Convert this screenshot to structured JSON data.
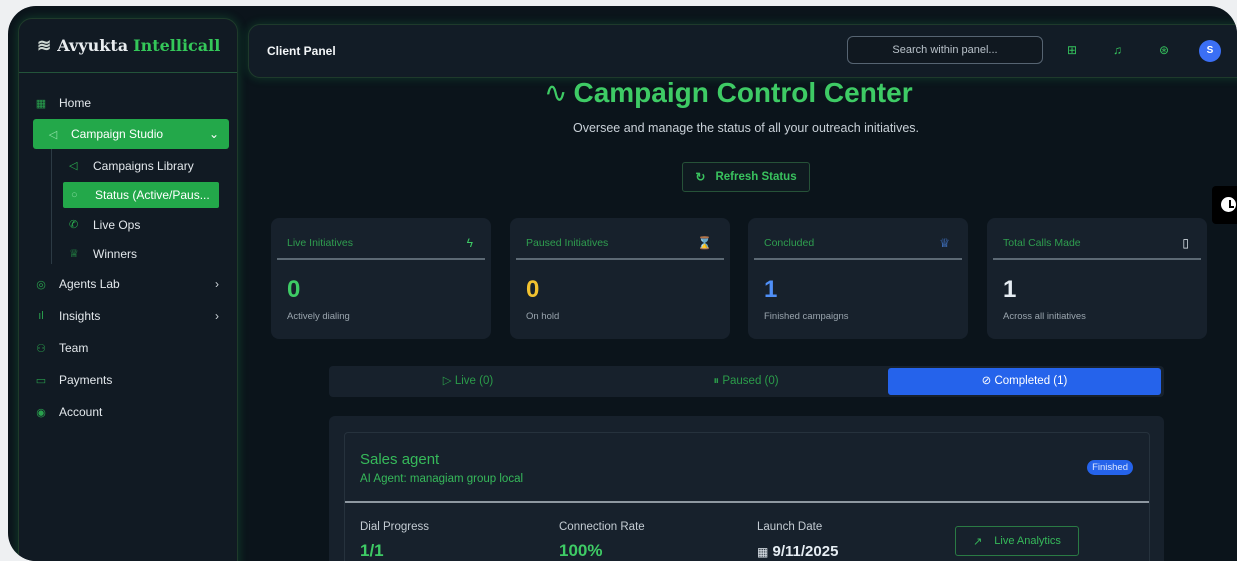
{
  "brand": {
    "part1": "Avyukta",
    "part2": "Intellicall"
  },
  "sidebar": {
    "items": [
      {
        "label": "Home",
        "icon": "grid-icon"
      },
      {
        "label": "Campaign Studio",
        "icon": "megaphone-icon"
      },
      {
        "label": "Agents Lab",
        "icon": "robot-icon"
      },
      {
        "label": "Insights",
        "icon": "bar-chart-icon"
      },
      {
        "label": "Team",
        "icon": "users-icon"
      },
      {
        "label": "Payments",
        "icon": "credit-card-icon"
      },
      {
        "label": "Account",
        "icon": "user-circle-icon"
      }
    ],
    "subitems": [
      {
        "label": "Campaigns Library",
        "icon": "megaphone-icon"
      },
      {
        "label": "Status (Active/Paus...",
        "icon": "circle-icon"
      },
      {
        "label": "Live Ops",
        "icon": "phone-icon"
      },
      {
        "label": "Winners",
        "icon": "trophy-icon"
      }
    ]
  },
  "topbar": {
    "title": "Client Panel",
    "search_placeholder": "Search within panel...",
    "avatar_letter": "S"
  },
  "main": {
    "title": "Campaign Control Center",
    "subtitle": "Oversee and manage the status of all your outreach initiatives.",
    "refresh_label": "Refresh Status"
  },
  "cards": [
    {
      "label": "Live Initiatives",
      "value": "0",
      "desc": "Actively dialing",
      "icon": "lightning-icon",
      "color": "#3ecb65"
    },
    {
      "label": "Paused Initiatives",
      "value": "0",
      "desc": "On hold",
      "icon": "hourglass-icon",
      "color": "#f2c230"
    },
    {
      "label": "Concluded",
      "value": "1",
      "desc": "Finished campaigns",
      "icon": "trophy-icon",
      "color": "#4f8ff7"
    },
    {
      "label": "Total Calls Made",
      "value": "1",
      "desc": "Across all initiatives",
      "icon": "phone-icon",
      "color": "#e6edf3"
    }
  ],
  "tabs": [
    {
      "label": "Live (0)",
      "icon": "play-icon"
    },
    {
      "label": "Paused (0)",
      "icon": "pause-icon"
    },
    {
      "label": "Completed (1)",
      "icon": "check-circle-icon"
    }
  ],
  "campaign": {
    "name": "Sales agent",
    "agent": "AI Agent: managiam group local",
    "badge": "Finished",
    "dial_progress_label": "Dial Progress",
    "dial_progress_value": "1/1",
    "connection_rate_label": "Connection Rate",
    "connection_rate_value": "100%",
    "launch_date_label": "Launch Date",
    "launch_date_value": "9/11/2025",
    "live_analytics_label": "Live Analytics"
  },
  "colors": {
    "accent": "#3ecb65",
    "primary": "#2563eb",
    "bg": "#0b141b"
  }
}
